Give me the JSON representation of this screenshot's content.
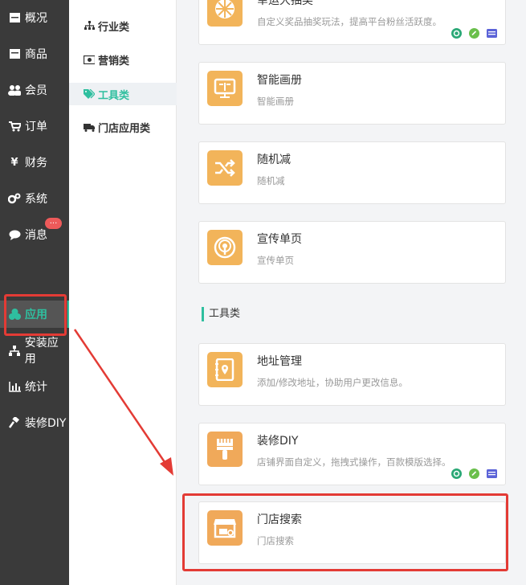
{
  "sidebar": {
    "items": [
      {
        "label": "概况",
        "icon": "dashboard-icon"
      },
      {
        "label": "商品",
        "icon": "goods-icon"
      },
      {
        "label": "会员",
        "icon": "users-icon"
      },
      {
        "label": "订单",
        "icon": "cart-icon"
      },
      {
        "label": "财务",
        "icon": "yen-icon"
      },
      {
        "label": "系统",
        "icon": "gears-icon"
      },
      {
        "label": "消息",
        "icon": "chat-icon"
      },
      {
        "label": "应用",
        "icon": "cubes-icon"
      },
      {
        "label": "安装应用",
        "icon": "sitemap-icon"
      },
      {
        "label": "统计",
        "icon": "bar-chart-icon"
      },
      {
        "label": "装修DIY",
        "icon": "gavel-icon"
      }
    ],
    "message_badge": "...",
    "active": "应用"
  },
  "subnav": {
    "items": [
      {
        "label": "行业类",
        "icon": "sitemap-icon"
      },
      {
        "label": "营销类",
        "icon": "money-icon"
      },
      {
        "label": "工具类",
        "icon": "tags-icon"
      },
      {
        "label": "门店应用类",
        "icon": "truck-icon"
      }
    ],
    "active": "工具类"
  },
  "cards_top": [
    {
      "title": "幸运大抽奖",
      "desc": "自定义奖品抽奖玩法，提高平台粉丝活跃度。",
      "platforms": [
        "wechat-mini-icon",
        "link-icon",
        "h5-icon"
      ]
    },
    {
      "title": "智能画册",
      "desc": "智能画册"
    },
    {
      "title": "随机减",
      "desc": "随机减"
    },
    {
      "title": "宣传单页",
      "desc": "宣传单页"
    }
  ],
  "section": {
    "title": "工具类"
  },
  "cards_tools": [
    {
      "title": "地址管理",
      "desc": "添加/修改地址，协助用户更改信息。"
    },
    {
      "title": "装修DIY",
      "desc": "店铺界面自定义，拖拽式操作，百款模版选择。",
      "platforms": [
        "wechat-mini-icon",
        "link-icon",
        "h5-icon"
      ]
    },
    {
      "title": "门店搜索",
      "desc": "门店搜索"
    }
  ],
  "colors": {
    "accent": "#2fbf9f",
    "icon_bg": "#f2b45a",
    "sidebar_bg": "#3a3a3a",
    "highlight": "#e33b35"
  }
}
